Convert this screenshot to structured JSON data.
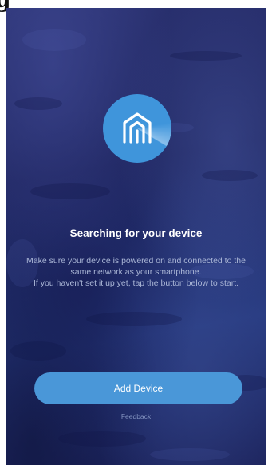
{
  "corner_glyph": "g",
  "logo": {
    "icon": "home-network-icon",
    "circle_color": "#3f95db"
  },
  "title": "Searching for your device",
  "description": {
    "line1": "Make sure your device is powered on and connected to the same network as your smartphone.",
    "line2": "If you haven't set it up yet, tap the button below to start."
  },
  "actions": {
    "add_device_label": "Add Device",
    "feedback_label": "Feedback"
  },
  "colors": {
    "background": "#232a68",
    "accent": "#4a97d8",
    "title_text": "#ffffff",
    "body_text": "#aab6d6"
  }
}
